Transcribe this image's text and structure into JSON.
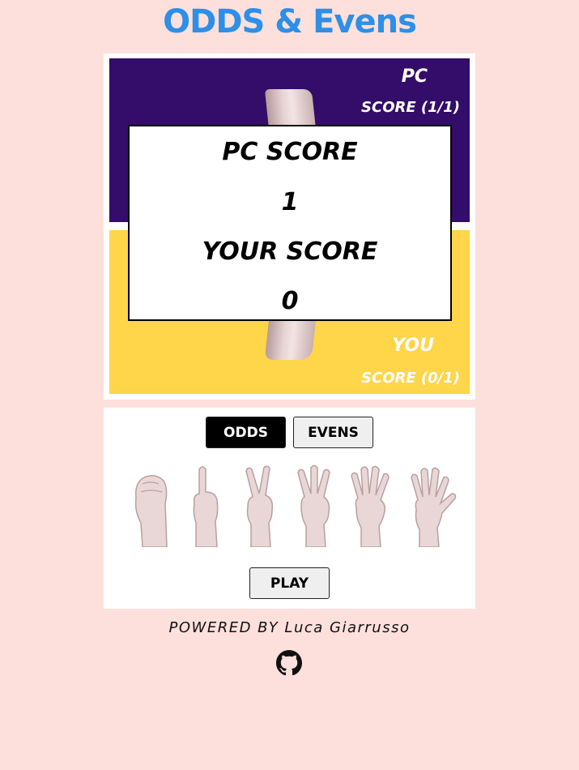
{
  "header": {
    "title": "ODDS & Evens"
  },
  "board": {
    "pc": {
      "label": "PC",
      "score": "SCORE (1/1)"
    },
    "you": {
      "label": "YOU",
      "score": "SCORE (0/1)"
    }
  },
  "modal": {
    "pc_title": "PC SCORE",
    "pc_value": "1",
    "your_title": "YOUR SCORE",
    "your_value": "0"
  },
  "controls": {
    "odds_label": "ODDS",
    "evens_label": "EVENS",
    "selected_choice": "odds",
    "play_label": "PLAY",
    "hands": [
      {
        "fingers": 0,
        "icon": "fist-hand-icon"
      },
      {
        "fingers": 1,
        "icon": "one-finger-hand-icon"
      },
      {
        "fingers": 2,
        "icon": "two-fingers-hand-icon"
      },
      {
        "fingers": 3,
        "icon": "three-fingers-hand-icon"
      },
      {
        "fingers": 4,
        "icon": "four-fingers-hand-icon"
      },
      {
        "fingers": 5,
        "icon": "five-fingers-hand-icon"
      }
    ]
  },
  "footer": {
    "powered_by": "POWERED BY Luca Giarrusso",
    "github_icon": "github-icon"
  },
  "colors": {
    "background": "#fde0dc",
    "title": "#2d8fe8",
    "pc_panel": "#330d69",
    "you_panel": "#ffd549"
  }
}
